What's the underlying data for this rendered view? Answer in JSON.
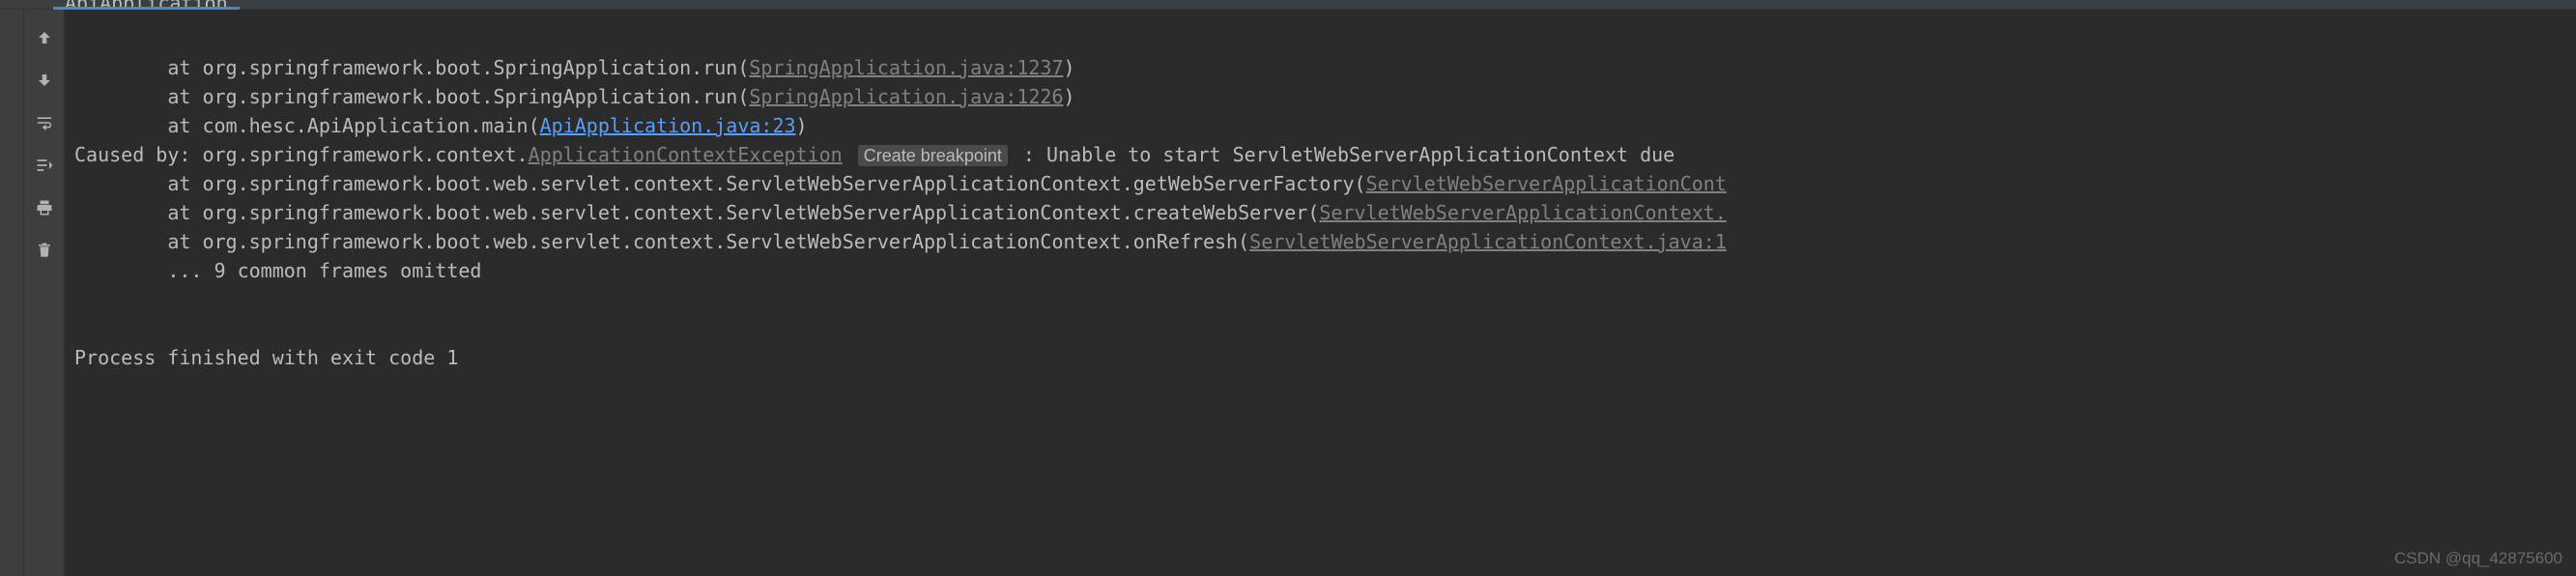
{
  "tab": {
    "label": "ApiApplication"
  },
  "console": {
    "line1_prefix": "        at org.springframework.boot.SpringApplication.run(",
    "line1_link": "SpringApplication.java:1237",
    "line1_suffix": ")",
    "line2_prefix": "        at org.springframework.boot.SpringApplication.run(",
    "line2_link": "SpringApplication.java:1226",
    "line2_suffix": ")",
    "line3_prefix": "        at com.hesc.ApiApplication.main(",
    "line3_link": "ApiApplication.java:23",
    "line3_suffix": ")",
    "line4_prefix": "Caused by: org.springframework.context.",
    "line4_exception": "ApplicationContextException",
    "line4_breakpoint": "Create breakpoint",
    "line4_suffix": " : Unable to start ServletWebServerApplicationContext due ",
    "line5_prefix": "        at org.springframework.boot.web.servlet.context.ServletWebServerApplicationContext.getWebServerFactory(",
    "line5_link": "ServletWebServerApplicationCont",
    "line6_prefix": "        at org.springframework.boot.web.servlet.context.ServletWebServerApplicationContext.createWebServer(",
    "line6_link": "ServletWebServerApplicationContext.",
    "line7_prefix": "        at org.springframework.boot.web.servlet.context.ServletWebServerApplicationContext.onRefresh(",
    "line7_link": "ServletWebServerApplicationContext.java:1",
    "line8": "        ... 9 common frames omitted",
    "line_blank": " ",
    "line9": "Process finished with exit code 1"
  },
  "watermark": "CSDN @qq_42875600"
}
